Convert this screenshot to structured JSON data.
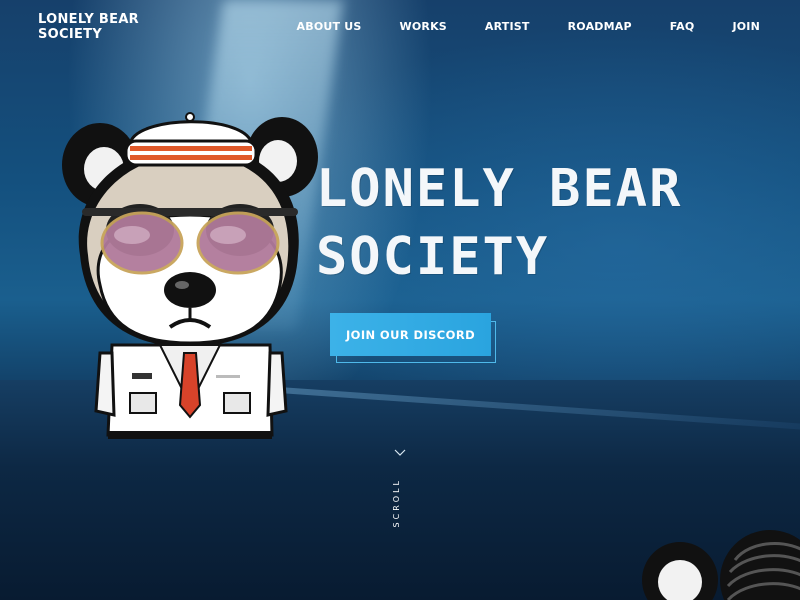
{
  "header": {
    "logo_line1": "LONELY BEAR",
    "logo_line2": "SOCIETY",
    "nav": [
      {
        "label": "ABOUT US"
      },
      {
        "label": "WORKS"
      },
      {
        "label": "ARTIST"
      },
      {
        "label": "ROADMAP"
      },
      {
        "label": "FAQ"
      },
      {
        "label": "JOIN"
      }
    ]
  },
  "hero": {
    "title_line1": "LONELY BEAR",
    "title_line2": "SOCIETY",
    "cta_label": "JOIN OUR DISCORD",
    "scroll_label": "SCROLL"
  },
  "colors": {
    "accent": "#3cb2e8",
    "text": "#ffffff"
  },
  "icons": {
    "scroll": "chevron-down-icon"
  }
}
